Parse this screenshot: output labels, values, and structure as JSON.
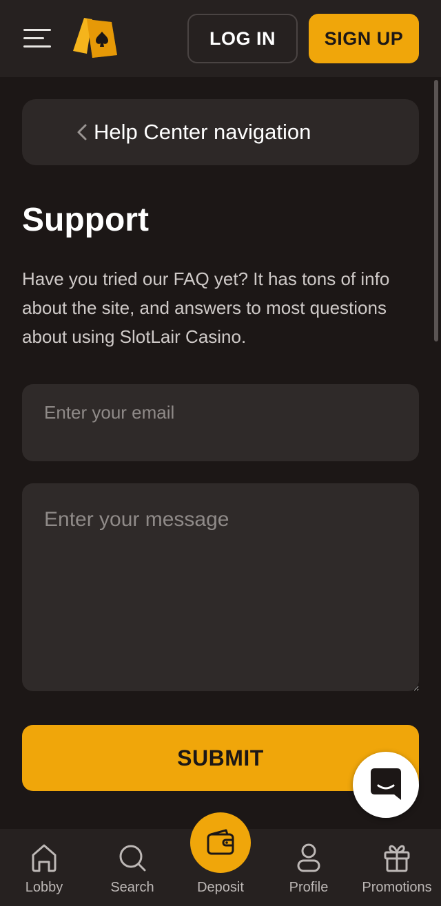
{
  "header": {
    "login_label": "LOG IN",
    "signup_label": "SIGN UP"
  },
  "help_nav": {
    "label": "Help Center navigation"
  },
  "support": {
    "title": "Support",
    "description": "Have you tried our FAQ yet? It has tons of info about the site, and answers to most questions about using SlotLair Casino."
  },
  "form": {
    "email_placeholder": "Enter your email",
    "message_placeholder": "Enter your message",
    "submit_label": "SUBMIT"
  },
  "bottom_nav": {
    "items": [
      {
        "label": "Lobby",
        "icon": "home-icon"
      },
      {
        "label": "Search",
        "icon": "search-icon"
      },
      {
        "label": "Deposit",
        "icon": "wallet-icon"
      },
      {
        "label": "Profile",
        "icon": "user-icon"
      },
      {
        "label": "Promotions",
        "icon": "gift-icon"
      }
    ]
  },
  "colors": {
    "accent": "#f0a60a",
    "background": "#1c1716",
    "surface": "#2d2827",
    "header": "#262120"
  }
}
